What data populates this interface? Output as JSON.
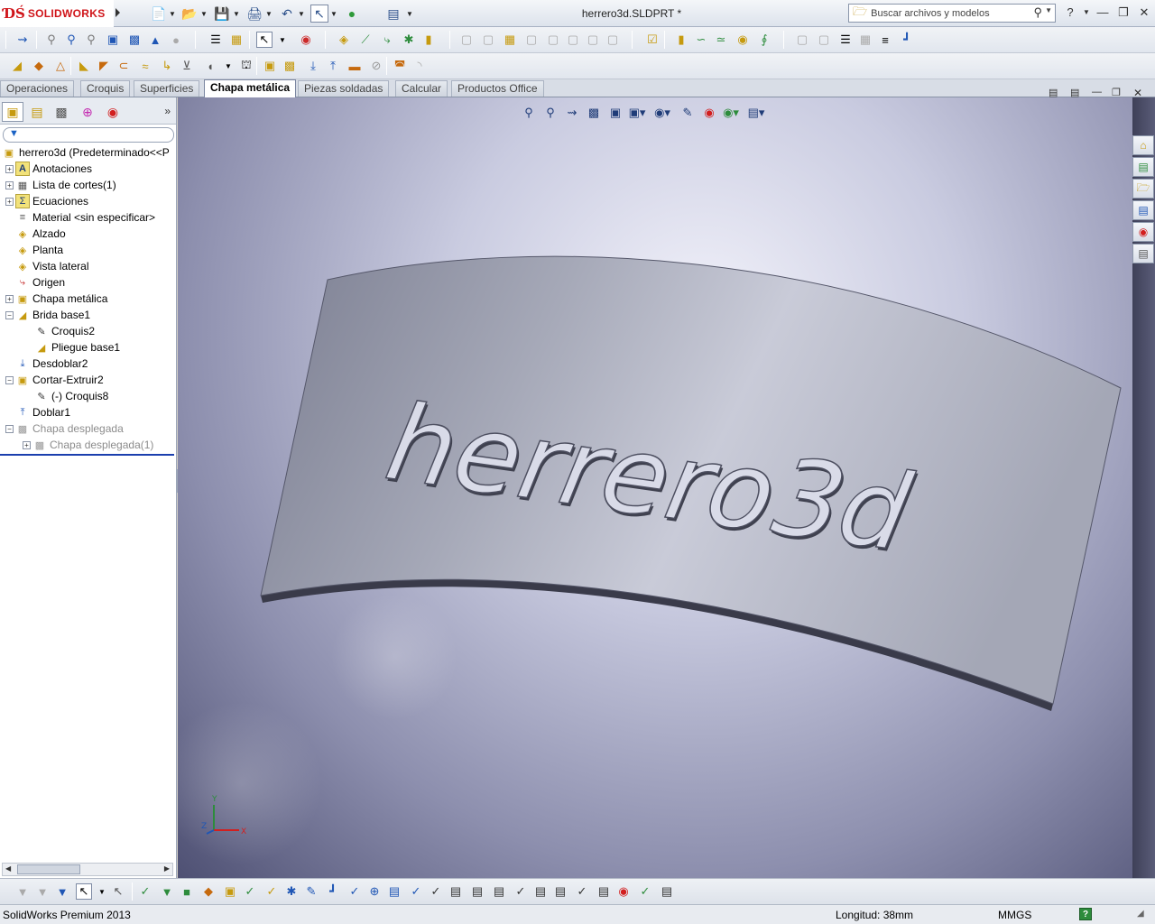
{
  "app": {
    "logo_mark": "ƊŚ",
    "logo_name": "SOLIDWORKS",
    "doc_title": "herrero3d.SLDPRT *",
    "search_placeholder": "Buscar archivos y modelos",
    "help_symbol": "?"
  },
  "command_tabs": [
    {
      "label": "Operaciones",
      "active": false
    },
    {
      "label": "Croquis",
      "active": false
    },
    {
      "label": "Superficies",
      "active": false
    },
    {
      "label": "Chapa metálica",
      "active": true
    },
    {
      "label": "Piezas soldadas",
      "active": false
    },
    {
      "label": "Calcular",
      "active": false
    },
    {
      "label": "Productos Office",
      "active": false
    }
  ],
  "feature_tree": {
    "root": "herrero3d  (Predeterminado<<P",
    "items": [
      {
        "label": "Anotaciones",
        "icon": "annotations-icon",
        "expandable": true
      },
      {
        "label": "Lista de cortes(1)",
        "icon": "cut-list-icon",
        "expandable": true
      },
      {
        "label": "Ecuaciones",
        "icon": "equations-icon",
        "expandable": true
      },
      {
        "label": "Material <sin especificar>",
        "icon": "material-icon",
        "expandable": false
      },
      {
        "label": "Alzado",
        "icon": "plane-icon",
        "expandable": false
      },
      {
        "label": "Planta",
        "icon": "plane-icon",
        "expandable": false
      },
      {
        "label": "Vista lateral",
        "icon": "plane-icon",
        "expandable": false
      },
      {
        "label": "Origen",
        "icon": "origin-icon",
        "expandable": false
      },
      {
        "label": "Chapa metálica",
        "icon": "sheet-metal-icon",
        "expandable": true
      },
      {
        "label": "Brida base1",
        "icon": "base-flange-icon",
        "expandable": true,
        "expanded": true
      },
      {
        "label": "Croquis2",
        "icon": "sketch-icon",
        "indent": 1
      },
      {
        "label": "Pliegue base1",
        "icon": "bend-icon",
        "indent": 1
      },
      {
        "label": "Desdoblar2",
        "icon": "unfold-icon",
        "expandable": false
      },
      {
        "label": "Cortar-Extruir2",
        "icon": "cut-extrude-icon",
        "expandable": true,
        "expanded": true
      },
      {
        "label": "(-) Croquis8",
        "icon": "sketch-icon",
        "indent": 1
      },
      {
        "label": "Doblar1",
        "icon": "fold-icon",
        "expandable": false
      },
      {
        "label": "Chapa desplegada",
        "icon": "flat-pattern-icon",
        "expandable": true,
        "expanded": true,
        "dim": true
      },
      {
        "label": "Chapa desplegada(1)",
        "icon": "flat-pattern-icon",
        "expandable": true,
        "indent": 1,
        "dim": true
      }
    ]
  },
  "model": {
    "engraved_text": "herrero3d"
  },
  "status": {
    "product": "SolidWorks Premium 2013",
    "measure": "Longitud: 38mm",
    "units": "MMGS",
    "help": "?"
  },
  "colors": {
    "brand": "#d0151a",
    "active_tab": "#ffffff",
    "viewport_bg": "#9a9cbb",
    "part_face": "#a0a3b2"
  }
}
